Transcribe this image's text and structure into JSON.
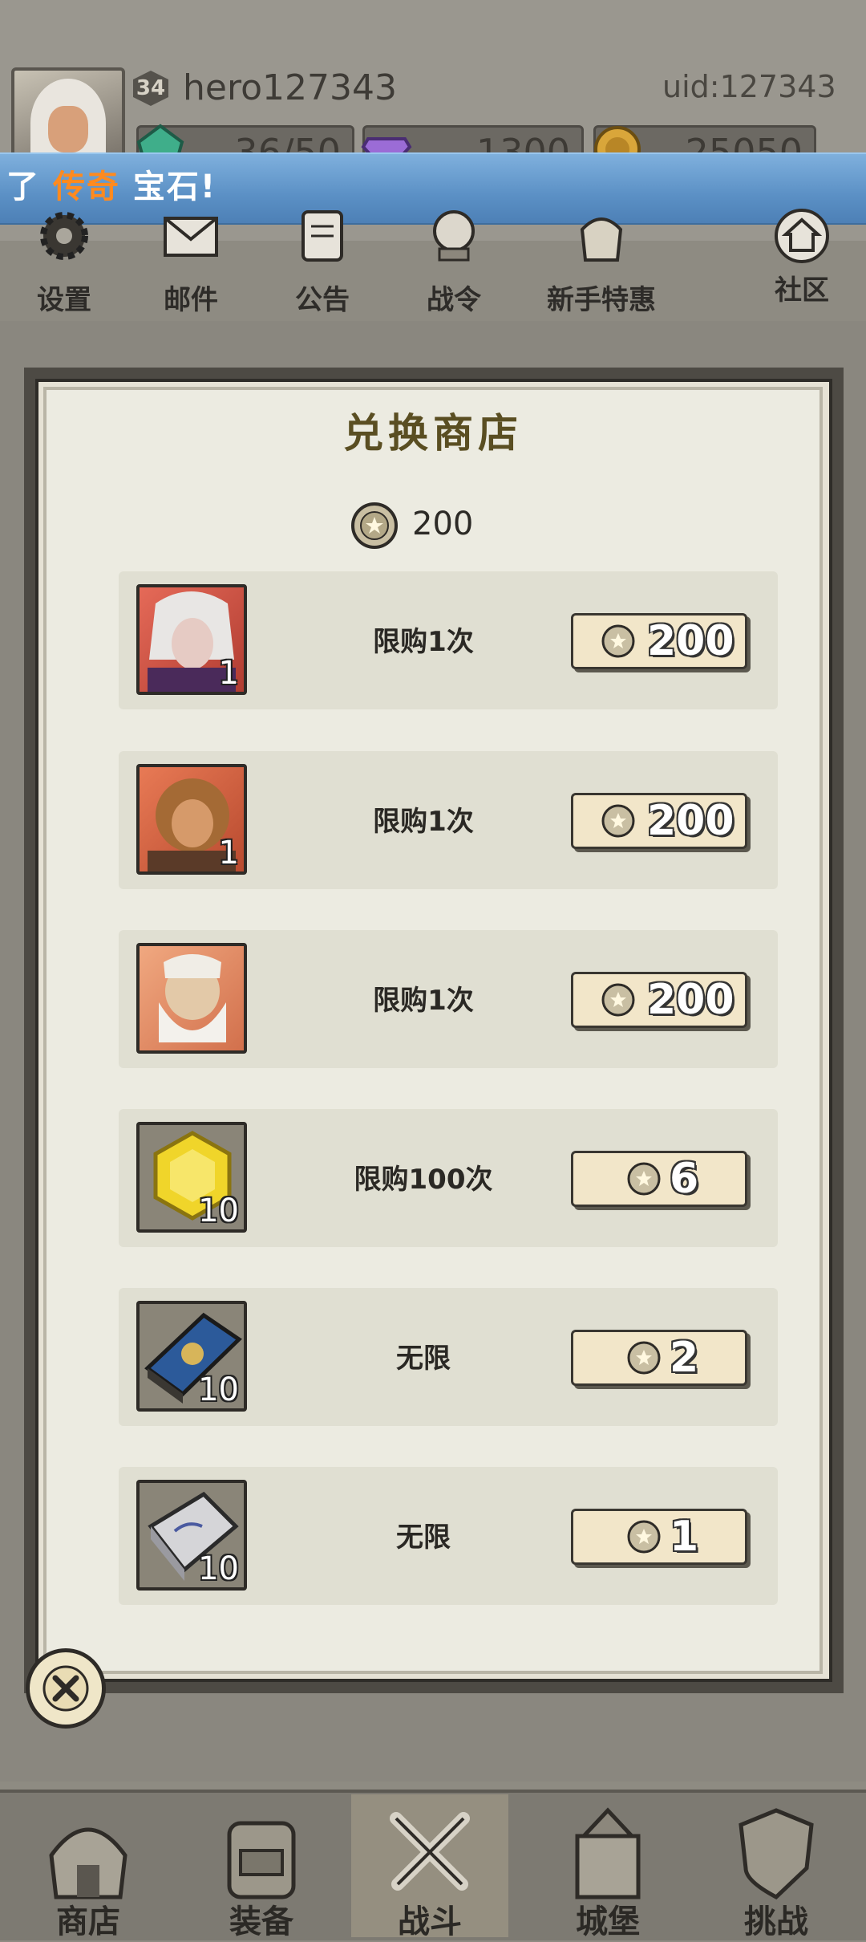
{
  "player": {
    "level": "34",
    "name": "hero127343",
    "uid": "uid:127343"
  },
  "resources": [
    {
      "icon": "green-gem-icon",
      "value": "36/50"
    },
    {
      "icon": "purple-diamond-icon",
      "value": "1300"
    },
    {
      "icon": "gold-coin-icon",
      "value": "25050"
    }
  ],
  "banner": {
    "prefix": "了",
    "highlight": "传奇",
    "suffix": "宝石!"
  },
  "menu": [
    {
      "icon": "gear-icon",
      "label": "设置"
    },
    {
      "icon": "mail-icon",
      "label": "邮件"
    },
    {
      "icon": "scroll-icon",
      "label": "公告"
    },
    {
      "icon": "battle-pass-icon",
      "label": "战令"
    },
    {
      "icon": "gift-bag-icon",
      "label": "新手特惠"
    },
    {
      "icon": "home-icon",
      "label": "社区"
    }
  ],
  "shop": {
    "title": "兑换商店",
    "balance": "200",
    "items": [
      {
        "name": "hero-silver-hair",
        "qty": "1",
        "limit": "限购1次",
        "price": "200"
      },
      {
        "name": "hero-monkey-king",
        "qty": "1",
        "limit": "限购1次",
        "price": "200"
      },
      {
        "name": "hero-old-sage",
        "qty": "",
        "limit": "限购1次",
        "price": "200"
      },
      {
        "name": "yellow-gem",
        "qty": "10",
        "limit": "限购100次",
        "price": "6"
      },
      {
        "name": "blue-tome",
        "qty": "10",
        "limit": "无限",
        "price": "2"
      },
      {
        "name": "silver-ingot",
        "qty": "10",
        "limit": "无限",
        "price": "1"
      }
    ]
  },
  "nav": [
    {
      "icon": "shop-hut-icon",
      "label": "商店"
    },
    {
      "icon": "backpack-icon",
      "label": "装备"
    },
    {
      "icon": "crossed-swords-icon",
      "label": "战斗",
      "active": true
    },
    {
      "icon": "castle-icon",
      "label": "城堡"
    },
    {
      "icon": "shield-icon",
      "label": "挑战"
    }
  ],
  "colors": {
    "banner": "#5b90c5",
    "highlight": "#ff8a1e",
    "modal_bg": "#ecebe1",
    "buy_bg": "#f2e6c9"
  }
}
